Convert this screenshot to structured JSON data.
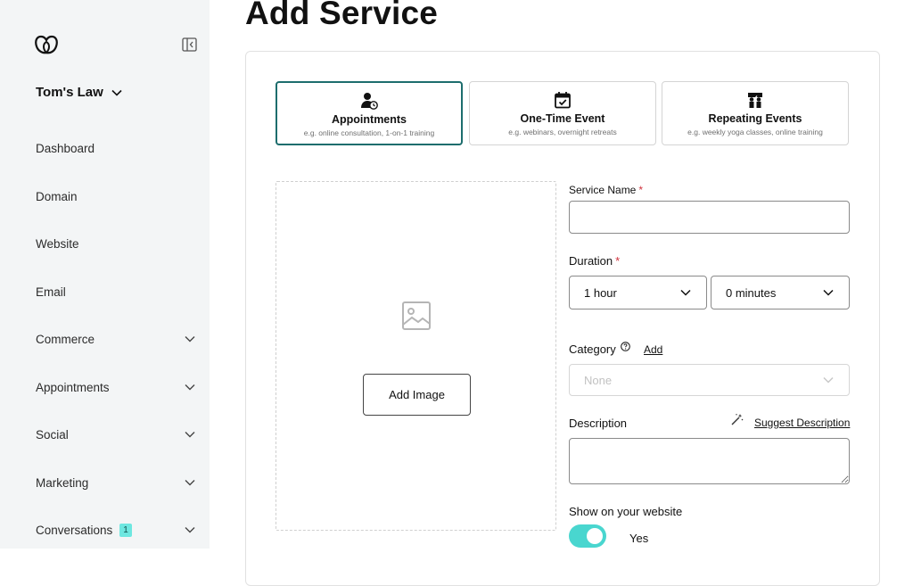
{
  "sidebar": {
    "business_name": "Tom's Law",
    "items": [
      {
        "label": "Dashboard",
        "has_chevron": false
      },
      {
        "label": "Domain",
        "has_chevron": false
      },
      {
        "label": "Website",
        "has_chevron": false
      },
      {
        "label": "Email",
        "has_chevron": false
      },
      {
        "label": "Commerce",
        "has_chevron": true
      },
      {
        "label": "Appointments",
        "has_chevron": true
      },
      {
        "label": "Social",
        "has_chevron": true
      },
      {
        "label": "Marketing",
        "has_chevron": true
      },
      {
        "label": "Conversations",
        "has_chevron": true,
        "badge": "1"
      }
    ]
  },
  "page": {
    "title": "Add Service"
  },
  "service_types": [
    {
      "title": "Appointments",
      "subtitle": "e.g. online consultation, 1-on-1 training",
      "icon": "person-clock-icon",
      "selected": true
    },
    {
      "title": "One-Time Event",
      "subtitle": "e.g. webinars, overnight retreats",
      "icon": "calendar-check-icon",
      "selected": false
    },
    {
      "title": "Repeating Events",
      "subtitle": "e.g. weekly yoga classes, online training",
      "icon": "people-repeat-icon",
      "selected": false
    }
  ],
  "image": {
    "button_label": "Add Image"
  },
  "form": {
    "service_name_label": "Service Name",
    "required_mark": "*",
    "service_name_value": "",
    "duration_label": "Duration",
    "duration_hours": "1 hour",
    "duration_minutes": "0 minutes",
    "category_label": "Category",
    "category_add": "Add",
    "category_value": "None",
    "description_label": "Description",
    "suggest_description": "Suggest Description",
    "description_value": "",
    "show_on_website_label": "Show on your website",
    "show_on_website_value": "Yes"
  },
  "colors": {
    "accent": "#1d6d6d",
    "toggle_on": "#49d6cf",
    "required": "#d0323c",
    "sidebar_bg": "#f3f5f6"
  }
}
